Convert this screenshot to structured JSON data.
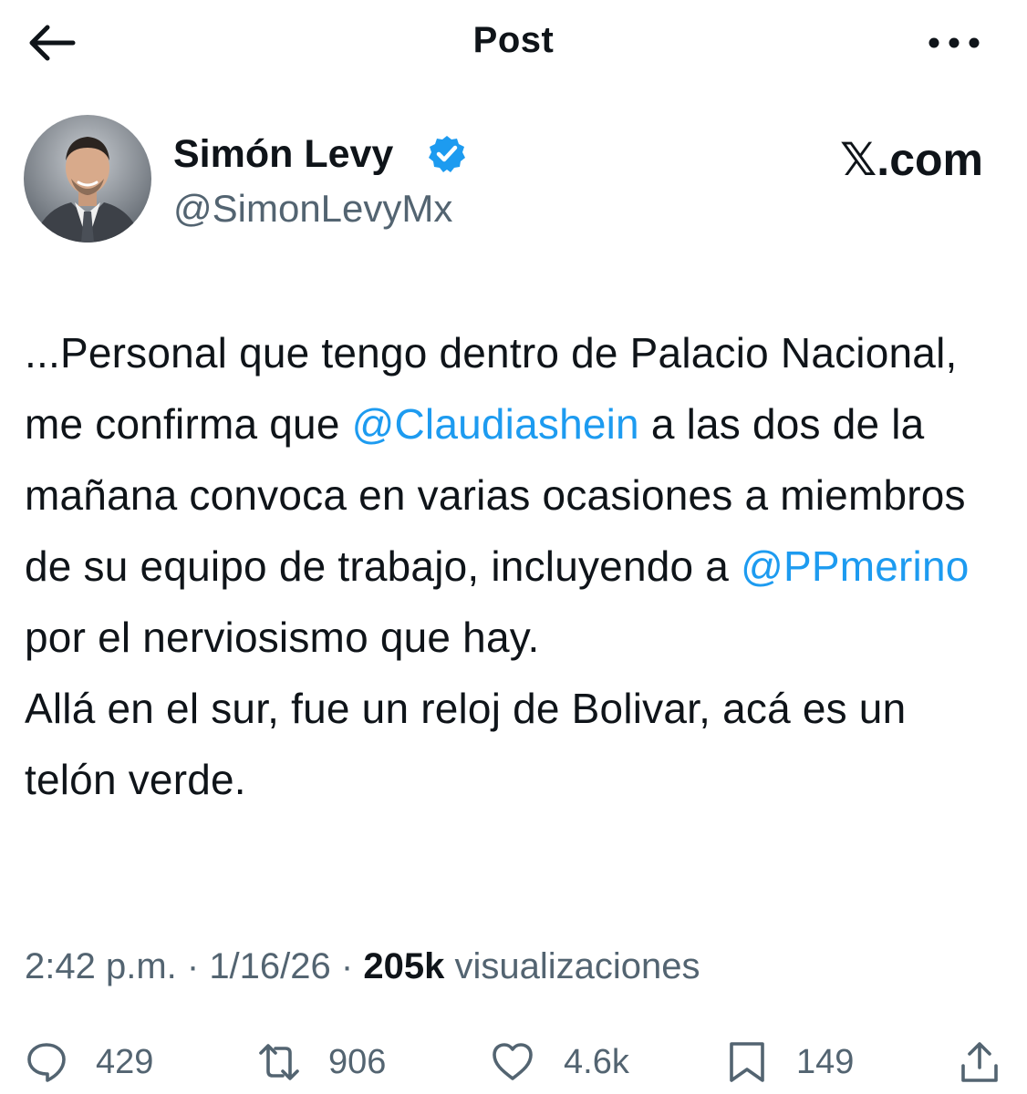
{
  "header": {
    "title": "Post",
    "back_icon": "arrow-left-icon",
    "more_icon": "more-horizontal-icon"
  },
  "author": {
    "name": "Simón Levy",
    "handle": "@SimonLevyMx",
    "verified": true,
    "verified_color": "#1d9bf0"
  },
  "source_label": "𝕏.com",
  "tweet": {
    "segments": [
      {
        "type": "text",
        "text": "...Personal que tengo dentro de Palacio Nacional, me confirma que "
      },
      {
        "type": "mention",
        "text": "@Claudiashein"
      },
      {
        "type": "text",
        "text": " a las dos de la mañana convoca en varias ocasiones a miembros de su equipo de trabajo, incluyendo a "
      },
      {
        "type": "mention",
        "text": "@PPmerino"
      },
      {
        "type": "text",
        "text": " por el nerviosismo que hay."
      },
      {
        "type": "break"
      },
      {
        "type": "text",
        "text": "Allá en el sur, fue un reloj de Bolivar, acá es un telón verde."
      }
    ],
    "mention_color": "#1d9bf0"
  },
  "meta": {
    "time": "2:42 p.m.",
    "separator": " · ",
    "date": "1/16/26",
    "views_count": "205k",
    "views_label": "visualizaciones"
  },
  "actions": {
    "replies": {
      "icon": "reply-icon",
      "count": "429"
    },
    "reposts": {
      "icon": "repost-icon",
      "count": "906"
    },
    "likes": {
      "icon": "heart-icon",
      "count": "4.6k"
    },
    "bookmarks": {
      "icon": "bookmark-icon",
      "count": "149"
    },
    "share": {
      "icon": "share-icon"
    }
  }
}
